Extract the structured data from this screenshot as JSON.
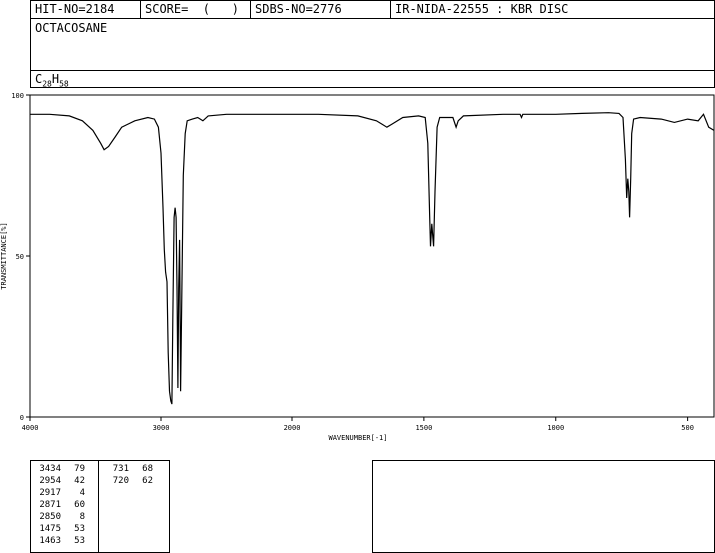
{
  "header": {
    "hit_no": "HIT-NO=2184",
    "score": "SCORE=  (   )",
    "sdbs_no": "SDBS-NO=2776",
    "ir_info": "IR-NIDA-22555 : KBR DISC"
  },
  "compound": {
    "name": "OCTACOSANE",
    "formula_c": "C",
    "formula_c_count": "28",
    "formula_h": "H",
    "formula_h_count": "58"
  },
  "chart_data": {
    "type": "line",
    "xlabel": "WAVENUMBER[-1]",
    "ylabel": "TRANSMITTANCE[%]",
    "xlim": [
      4000,
      400
    ],
    "ylim": [
      0,
      100
    ],
    "x_ticks": [
      4000,
      3000,
      2000,
      1500,
      1000,
      500
    ],
    "y_ticks": [
      0,
      50,
      100
    ],
    "series": [
      {
        "points": [
          [
            4000,
            94
          ],
          [
            3850,
            94
          ],
          [
            3700,
            93.5
          ],
          [
            3600,
            92
          ],
          [
            3520,
            89
          ],
          [
            3460,
            85
          ],
          [
            3434,
            83
          ],
          [
            3400,
            84
          ],
          [
            3350,
            87
          ],
          [
            3300,
            90
          ],
          [
            3200,
            92
          ],
          [
            3100,
            93
          ],
          [
            3050,
            92.5
          ],
          [
            3020,
            90
          ],
          [
            3000,
            82
          ],
          [
            2985,
            65
          ],
          [
            2975,
            52
          ],
          [
            2965,
            45
          ],
          [
            2954,
            42
          ],
          [
            2945,
            20
          ],
          [
            2935,
            8
          ],
          [
            2925,
            5
          ],
          [
            2917,
            4
          ],
          [
            2910,
            30
          ],
          [
            2900,
            62
          ],
          [
            2892,
            65
          ],
          [
            2885,
            62
          ],
          [
            2878,
            40
          ],
          [
            2871,
            9
          ],
          [
            2865,
            40
          ],
          [
            2858,
            55
          ],
          [
            2852,
            20
          ],
          [
            2850,
            8
          ],
          [
            2842,
            35
          ],
          [
            2830,
            75
          ],
          [
            2815,
            88
          ],
          [
            2800,
            92
          ],
          [
            2760,
            92.5
          ],
          [
            2720,
            93
          ],
          [
            2680,
            92
          ],
          [
            2640,
            93.5
          ],
          [
            2500,
            94
          ],
          [
            2200,
            94
          ],
          [
            1900,
            94
          ],
          [
            1750,
            93.5
          ],
          [
            1680,
            92
          ],
          [
            1640,
            90
          ],
          [
            1620,
            91
          ],
          [
            1580,
            93
          ],
          [
            1520,
            93.5
          ],
          [
            1495,
            93
          ],
          [
            1485,
            85
          ],
          [
            1478,
            62
          ],
          [
            1475,
            53
          ],
          [
            1470,
            60
          ],
          [
            1466,
            56
          ],
          [
            1463,
            53
          ],
          [
            1458,
            70
          ],
          [
            1450,
            90
          ],
          [
            1440,
            93
          ],
          [
            1390,
            93
          ],
          [
            1378,
            90
          ],
          [
            1370,
            92
          ],
          [
            1350,
            93.5
          ],
          [
            1200,
            94
          ],
          [
            1135,
            94
          ],
          [
            1130,
            93
          ],
          [
            1125,
            94
          ],
          [
            1000,
            94
          ],
          [
            900,
            94.3
          ],
          [
            800,
            94.5
          ],
          [
            760,
            94.3
          ],
          [
            745,
            93
          ],
          [
            736,
            80
          ],
          [
            731,
            68
          ],
          [
            727,
            74
          ],
          [
            723,
            70
          ],
          [
            720,
            62
          ],
          [
            716,
            74
          ],
          [
            712,
            88
          ],
          [
            705,
            92.5
          ],
          [
            680,
            93
          ],
          [
            600,
            92.5
          ],
          [
            550,
            91.5
          ],
          [
            500,
            92.5
          ],
          [
            460,
            92
          ],
          [
            440,
            94
          ],
          [
            420,
            90
          ],
          [
            400,
            89
          ]
        ]
      }
    ],
    "peak_table": [
      [
        3434,
        79
      ],
      [
        2954,
        42
      ],
      [
        2917,
        4
      ],
      [
        2871,
        60
      ],
      [
        2850,
        8
      ],
      [
        1475,
        53
      ],
      [
        1463,
        53
      ],
      [
        731,
        68
      ],
      [
        720,
        62
      ]
    ]
  }
}
